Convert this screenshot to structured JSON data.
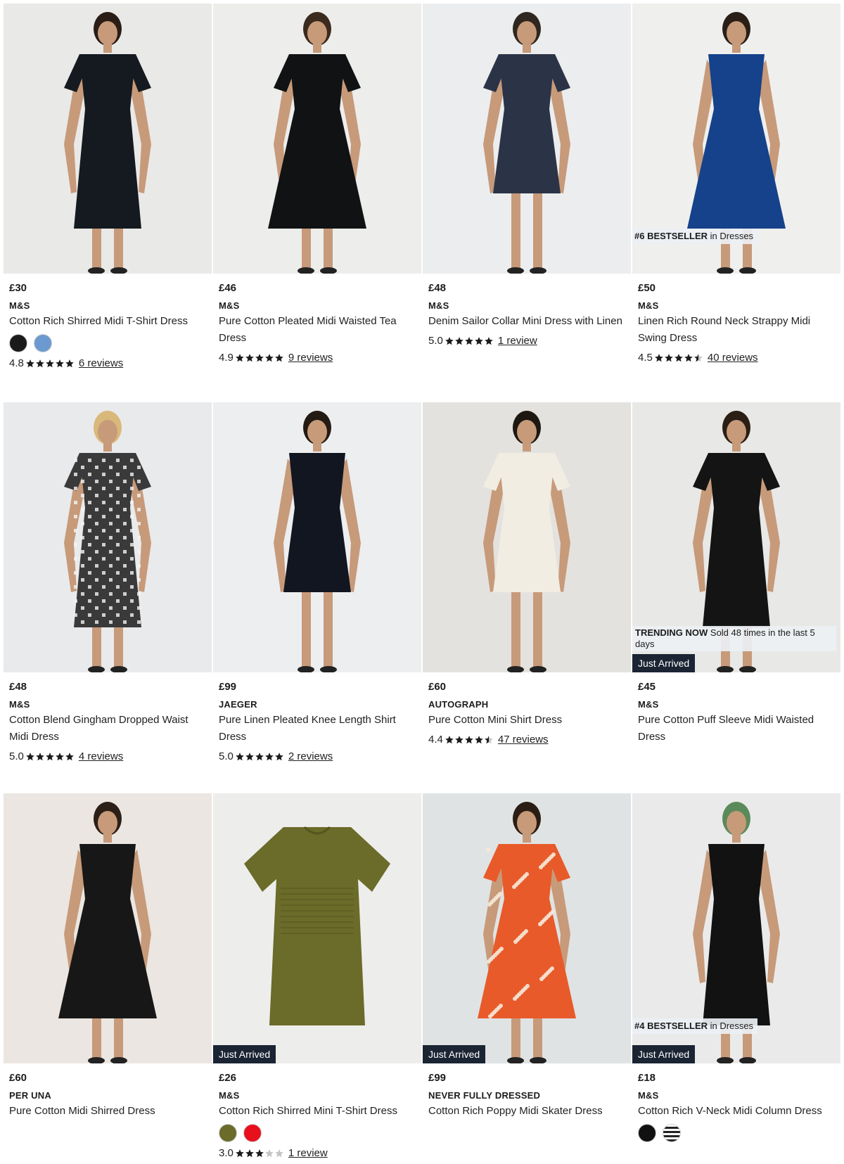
{
  "colors": {
    "just_arrived_bg": "#1b2433",
    "badge_bg": "#ecf0f4",
    "star": "#1c1c1c",
    "star_empty": "#c4c4c4"
  },
  "products": [
    {
      "price": "£30",
      "brand": "M&S",
      "name": "Cotton Rich Shirred Midi T-Shirt Dress",
      "swatches": [
        "#1a1a1a",
        "#6c9ad0"
      ],
      "rating": "4.8",
      "stars": 5,
      "reviews": "6 reviews"
    },
    {
      "price": "£46",
      "brand": "M&S",
      "name": "Pure Cotton Pleated Midi Waisted Tea Dress",
      "rating": "4.9",
      "stars": 5,
      "reviews": "9 reviews"
    },
    {
      "price": "£48",
      "brand": "M&S",
      "name": "Denim Sailor Collar Mini Dress with Linen",
      "rating": "5.0",
      "stars": 5,
      "reviews": "1 review"
    },
    {
      "price": "£50",
      "brand": "M&S",
      "name": "Linen Rich Round Neck Strappy Midi Swing Dress",
      "rating": "4.5",
      "stars": 4.5,
      "reviews": "40 reviews",
      "badge_rank": "#6 BESTSELLER",
      "badge_rest": " in Dresses"
    },
    {
      "price": "£48",
      "brand": "M&S",
      "name": "Cotton Blend Gingham Dropped Waist Midi Dress",
      "rating": "5.0",
      "stars": 5,
      "reviews": "4 reviews"
    },
    {
      "price": "£99",
      "brand": "JAEGER",
      "name": "Pure Linen Pleated Knee Length Shirt Dress",
      "rating": "5.0",
      "stars": 5,
      "reviews": "2 reviews"
    },
    {
      "price": "£60",
      "brand": "AUTOGRAPH",
      "name": "Pure Cotton Mini Shirt Dress",
      "rating": "4.4",
      "stars": 4.5,
      "reviews": "47 reviews"
    },
    {
      "price": "£45",
      "brand": "M&S",
      "name": "Pure Cotton Puff Sleeve Midi Waisted Dress",
      "trending_bold": "TRENDING NOW",
      "trending_rest": " Sold 48 times in the last 5 days",
      "just_arrived": "Just Arrived"
    },
    {
      "price": "£60",
      "brand": "PER UNA",
      "name": "Pure Cotton Midi Shirred Dress"
    },
    {
      "price": "£26",
      "brand": "M&S",
      "name": "Cotton Rich Shirred Mini T-Shirt Dress",
      "swatches": [
        "#6b6b2a",
        "#e8101c"
      ],
      "rating": "3.0",
      "stars": 3,
      "reviews": "1 review",
      "just_arrived": "Just Arrived"
    },
    {
      "price": "£99",
      "brand": "NEVER FULLY DRESSED",
      "name": "Cotton Rich Poppy Midi Skater Dress",
      "just_arrived": "Just Arrived"
    },
    {
      "price": "£18",
      "brand": "M&S",
      "name": "Cotton Rich V-Neck Midi Column Dress",
      "swatches": [
        "#111111",
        "stripe"
      ],
      "badge_rank": "#4 BESTSELLER",
      "badge_rest": " in Dresses",
      "just_arrived": "Just Arrived"
    }
  ]
}
